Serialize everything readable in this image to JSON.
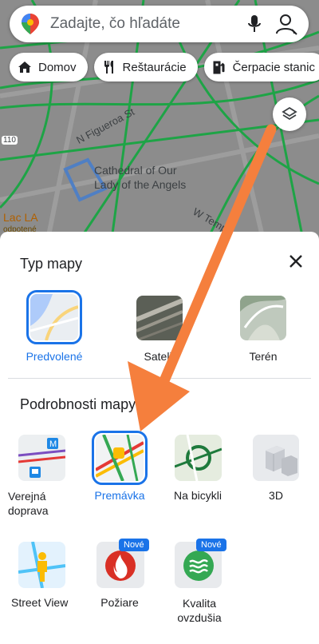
{
  "search": {
    "placeholder": "Zadajte, čo hľadáte"
  },
  "chips": [
    {
      "label": "Domov",
      "icon": "home-icon"
    },
    {
      "label": "Reštaurácie",
      "icon": "restaurant-icon"
    },
    {
      "label": "Čerpacie stanic",
      "icon": "gas-station-icon"
    }
  ],
  "map_labels": {
    "street1": "N Figueroa St",
    "landmark": "Cathedral of Our Lady of the Angels",
    "street2": "W Temp",
    "place": "Lac LA",
    "place_sub": "odpotené",
    "route": "110"
  },
  "sheet": {
    "map_type_title": "Typ mapy",
    "map_details_title": "Podrobnosti mapy",
    "map_types": [
      {
        "label": "Predvolené",
        "selected": true
      },
      {
        "label": "Satelit",
        "selected": false
      },
      {
        "label": "Terén",
        "selected": false
      }
    ],
    "details": [
      {
        "label": "Verejná doprava",
        "selected": false
      },
      {
        "label": "Premávka",
        "selected": true
      },
      {
        "label": "Na bicykli",
        "selected": false
      },
      {
        "label": "3D",
        "selected": false
      },
      {
        "label": "Street View",
        "selected": false
      },
      {
        "label": "Požiare",
        "selected": false,
        "badge": "Nové"
      },
      {
        "label": "Kvalita ovzdušia",
        "selected": false,
        "badge": "Nové"
      }
    ]
  },
  "colors": {
    "accent": "#1a73e8",
    "arrow": "#f57f3d",
    "traffic": "#1ea446"
  }
}
